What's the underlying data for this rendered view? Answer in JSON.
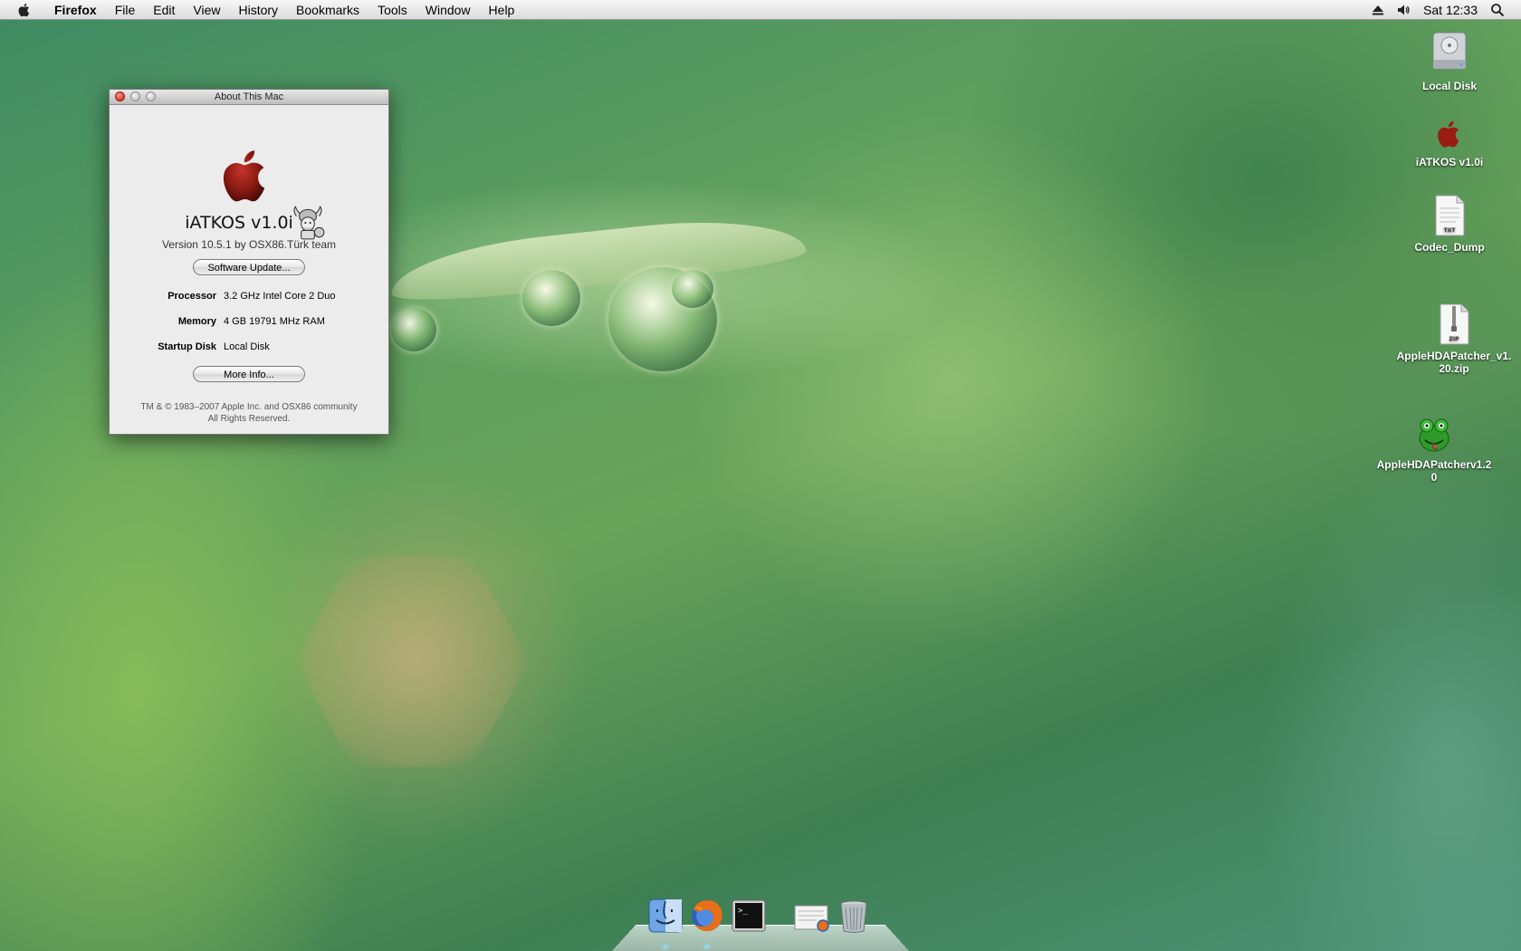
{
  "menubar": {
    "app_name": "Firefox",
    "items": [
      "File",
      "Edit",
      "View",
      "History",
      "Bookmarks",
      "Tools",
      "Window",
      "Help"
    ],
    "clock": "Sat 12:33"
  },
  "about_window": {
    "title": "About This Mac",
    "os_name": "iATKOS v1.0i",
    "version": "Version 10.5.1 by OSX86.Türk team",
    "software_update_label": "Software Update...",
    "processor_label": "Processor",
    "processor_value": "3.2 GHz Intel Core 2 Duo",
    "memory_label": "Memory",
    "memory_value": "4 GB 19791 MHz RAM",
    "startup_disk_label": "Startup Disk",
    "startup_disk_value": "Local Disk",
    "more_info_label": "More Info...",
    "copyright_line1": "TM & © 1983–2007 Apple Inc. and OSX86 community",
    "copyright_line2": "All Rights Reserved."
  },
  "desktop_icons": [
    {
      "label": "Local Disk",
      "icon": "hard-disk-icon"
    },
    {
      "label": "iATKOS v1.0i",
      "icon": "apple-volume-icon"
    },
    {
      "label": "Codec_Dump",
      "icon": "txt-document-icon"
    },
    {
      "label": "AppleHDAPatcher_v1.20.zip",
      "icon": "zip-archive-icon"
    },
    {
      "label": "AppleHDAPatcherv1.20",
      "icon": "frog-app-icon"
    }
  ],
  "dock": {
    "items": [
      "finder-icon",
      "firefox-icon",
      "terminal-icon",
      "downloads-stack-icon",
      "trash-icon"
    ]
  },
  "colors": {
    "close_button": "#d8322a",
    "apple_logo_red": "#9a1d14",
    "dock_indicator": "#8fd6ff"
  }
}
